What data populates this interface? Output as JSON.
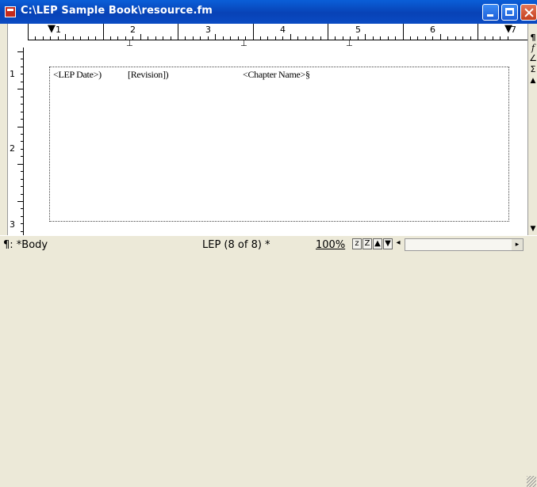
{
  "window": {
    "title": "C:\\LEP Sample Book\\resource.fm"
  },
  "ruler": {
    "numbers": [
      "1",
      "2",
      "3",
      "4",
      "5",
      "6",
      "7"
    ]
  },
  "vruler": {
    "numbers": [
      "1",
      "2",
      "3"
    ]
  },
  "document": {
    "frame_texts": {
      "lep_date": "<LEP Date>)",
      "revision": "[Revision])",
      "chapter_name": "<Chapter Name>§"
    }
  },
  "right_toolbar": {
    "items": [
      "¶",
      "f",
      "∠",
      "Σ"
    ]
  },
  "status": {
    "paragraph_format": "¶: *Body",
    "page": "LEP (8 of 8) *",
    "zoom": "100%",
    "zoom_out": "z",
    "zoom_in": "Z"
  }
}
